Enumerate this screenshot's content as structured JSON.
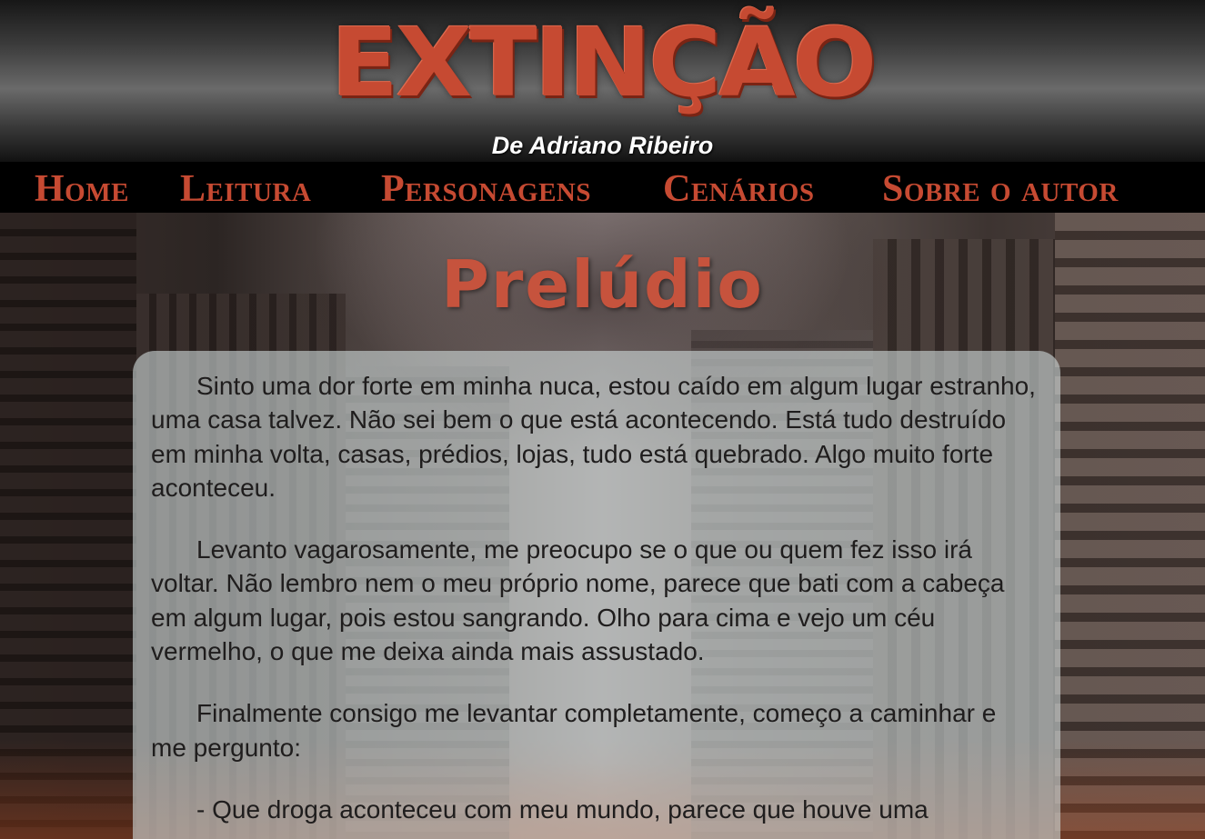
{
  "header": {
    "title": "EXTINÇÃO",
    "author": "De Adriano Ribeiro"
  },
  "nav": {
    "items": [
      {
        "label": "Home"
      },
      {
        "label": "Leitura"
      },
      {
        "label": "Personagens"
      },
      {
        "label": "Cenários"
      },
      {
        "label": "Sobre o autor"
      }
    ]
  },
  "colors": {
    "accent": "#c64a32",
    "nav_background": "#000000",
    "panel_background": "#cdd6d7",
    "text": "#1f1d1d"
  },
  "chapter": {
    "title": "Prelúdio",
    "paragraphs": [
      "Sinto uma dor forte em minha nuca, estou caído em algum lugar estranho, uma casa talvez. Não sei bem o que está acontecendo. Está tudo destruído em minha volta, casas, prédios, lojas, tudo está quebrado. Algo muito forte aconteceu.",
      "Levanto vagarosamente, me preocupo se o que ou quem fez isso irá voltar. Não lembro nem o meu próprio nome, parece que bati com a cabeça em algum lugar, pois estou sangrando. Olho para cima e vejo um céu vermelho, o que me deixa ainda mais assustado.",
      "Finalmente consigo me levantar completamente, começo a caminhar e me pergunto:",
      "- Que droga aconteceu com meu mundo, parece que houve uma"
    ]
  }
}
